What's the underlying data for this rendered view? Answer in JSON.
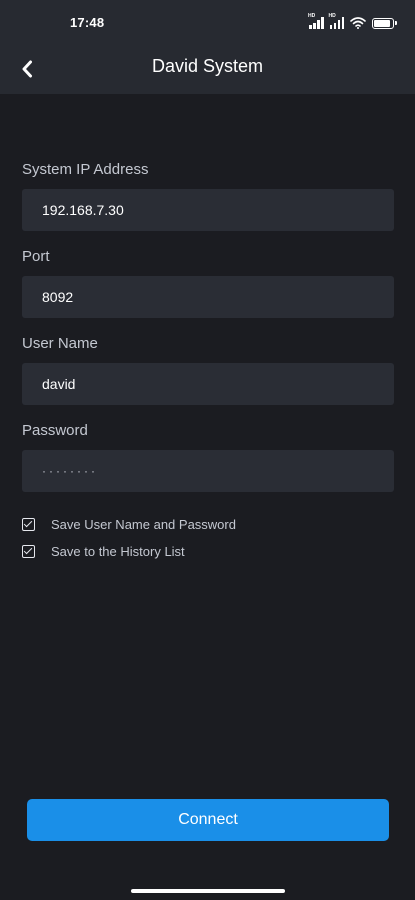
{
  "status_bar": {
    "time": "17:48",
    "signal_badges": [
      "HD",
      "HD"
    ]
  },
  "header": {
    "title": "David System",
    "back_icon": "chevron-left-icon"
  },
  "form": {
    "ip": {
      "label": "System IP Address",
      "value": "192.168.7.30"
    },
    "port": {
      "label": "Port",
      "value": "8092"
    },
    "username": {
      "label": "User Name",
      "value": "david"
    },
    "password": {
      "label": "Password",
      "value": "········"
    }
  },
  "options": {
    "save_credentials": {
      "label": "Save User Name and Password",
      "checked": true
    },
    "save_history": {
      "label": "Save to the History List",
      "checked": true
    }
  },
  "actions": {
    "connect_label": "Connect"
  },
  "colors": {
    "background": "#1b1c21",
    "bar": "#272a31",
    "field": "#2a2d35",
    "accent": "#1a8fe8"
  }
}
